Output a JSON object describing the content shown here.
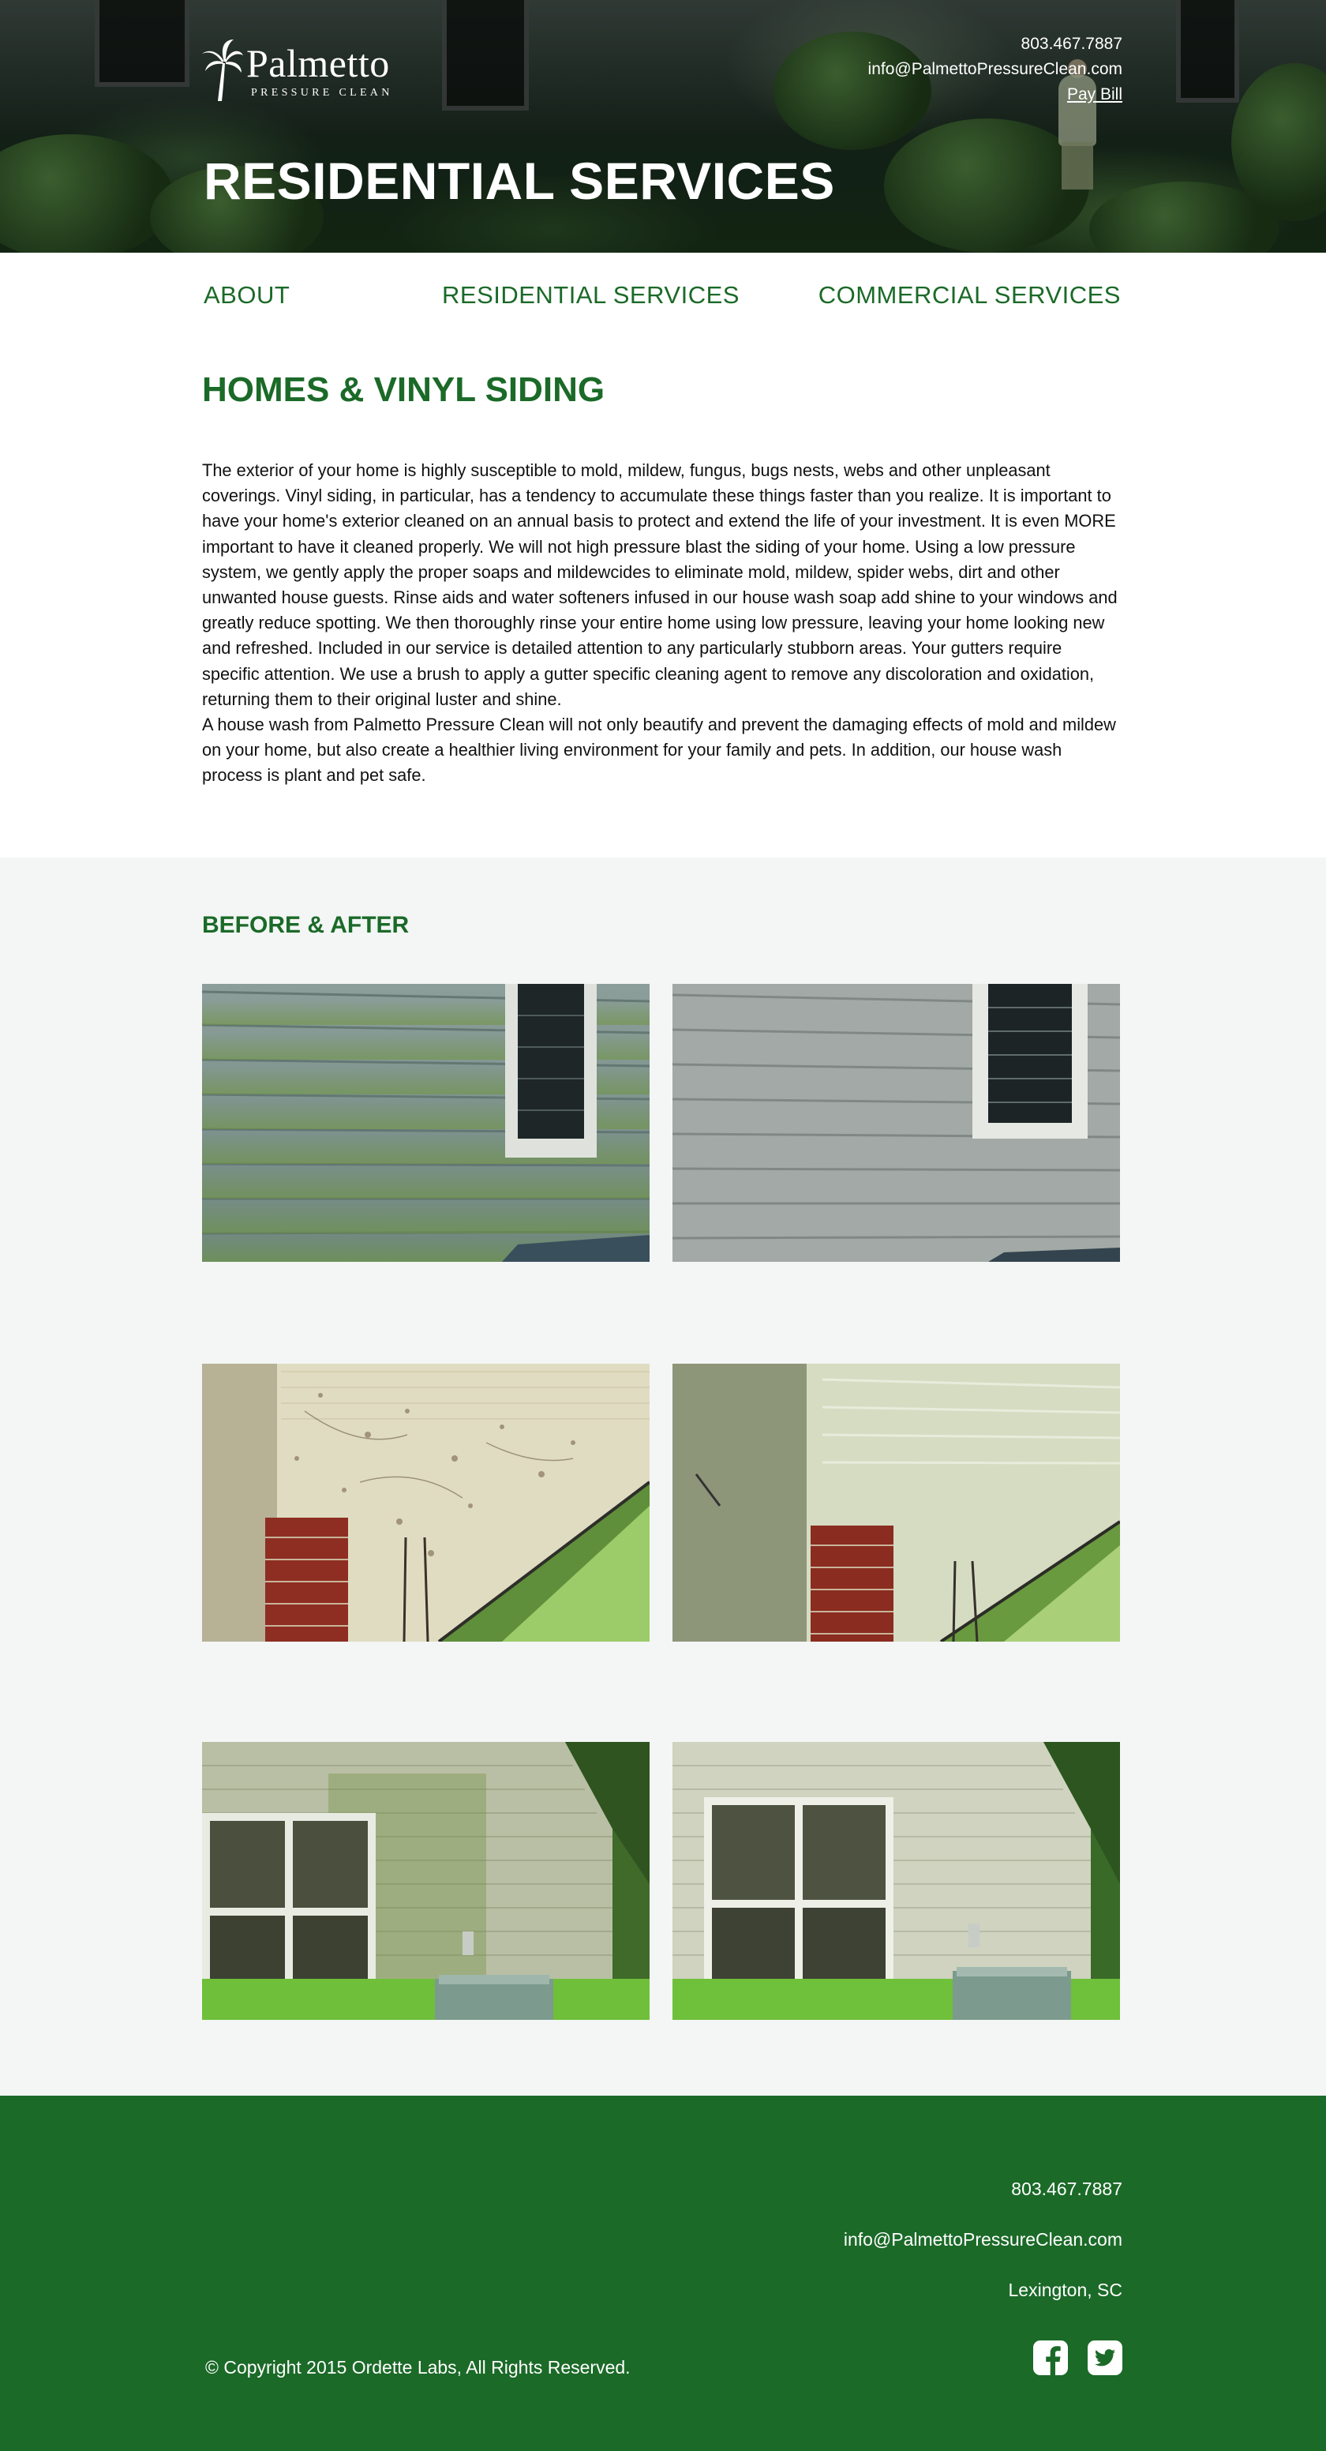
{
  "header": {
    "logo": {
      "name": "Palmetto",
      "tagline": "PRESSURE CLEAN"
    },
    "phone": "803.467.7887",
    "email": "info@PalmettoPressureClean.com",
    "pay_bill": "Pay Bill",
    "title": "RESIDENTIAL SERVICES"
  },
  "nav": {
    "items": [
      {
        "label": "ABOUT"
      },
      {
        "label": "RESIDENTIAL SERVICES"
      },
      {
        "label": "COMMERCIAL SERVICES"
      }
    ]
  },
  "main": {
    "heading": "HOMES & VINYL SIDING",
    "paragraphs": [
      "The exterior of your home is highly susceptible to mold, mildew, fungus, bugs nests, webs and other unpleasant coverings.  Vinyl siding, in particular, has a tendency to accumulate these things faster than you realize.  It is important to have your home's exterior cleaned on an annual basis to protect and extend the life of your investment.  It is even MORE important to have it cleaned properly.  We will not high pressure blast the siding of your home. Using a low pressure system, we gently apply the proper soaps and mildewcides to eliminate mold, mildew, spider webs, dirt and other unwanted house guests. Rinse aids and water softeners infused in our house wash soap add shine to your windows and greatly reduce spotting.  We then thoroughly rinse your entire home using low pressure, leaving your home looking new and refreshed.  Included in our service is detailed attention to any particularly stubborn areas.  Your gutters require specific attention.  We use a brush to apply a gutter specific cleaning agent to remove any discoloration and oxidation, returning them to their original luster and shine.",
      "A house wash from Palmetto Pressure Clean will not only beautify and prevent the damaging effects of mold and mildew on your home, but also create a healthier living environment for your family and pets.  In addition, our house wash process is plant and pet safe."
    ]
  },
  "before_after": {
    "heading": "BEFORE & AFTER"
  },
  "footer": {
    "phone": "803.467.7887",
    "email": "info@PalmettoPressureClean.com",
    "location": "Lexington, SC",
    "copyright": "© Copyright 2015 Ordette Labs, All Rights Reserved.",
    "social": [
      "facebook-icon",
      "twitter-icon"
    ]
  },
  "colors": {
    "brand_green": "#1b6a28",
    "section_bg": "#f3f6f5",
    "text": "#111111"
  }
}
